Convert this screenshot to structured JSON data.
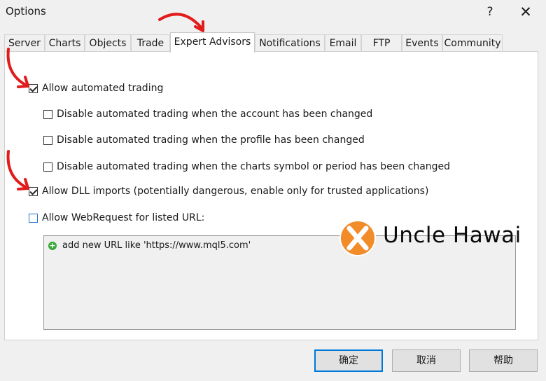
{
  "window": {
    "title": "Options",
    "help_glyph": "?",
    "close_glyph": "✕"
  },
  "tabs": [
    {
      "label": "Server",
      "active": false
    },
    {
      "label": "Charts",
      "active": false
    },
    {
      "label": "Objects",
      "active": false
    },
    {
      "label": "Trade",
      "active": false
    },
    {
      "label": "Expert Advisors",
      "active": true
    },
    {
      "label": "Notifications",
      "active": false
    },
    {
      "label": "Email",
      "active": false
    },
    {
      "label": "FTP",
      "active": false
    },
    {
      "label": "Events",
      "active": false
    },
    {
      "label": "Community",
      "active": false
    }
  ],
  "options": {
    "allow_automated": {
      "label": "Allow automated trading",
      "checked": true
    },
    "disable_account": {
      "label": "Disable automated trading when the account has been changed",
      "checked": false
    },
    "disable_profile": {
      "label": "Disable automated trading when the profile has been changed",
      "checked": false
    },
    "disable_symbol": {
      "label": "Disable automated trading when the charts symbol or period has been changed",
      "checked": false
    },
    "allow_dll": {
      "label": "Allow DLL imports (potentially dangerous, enable only for trusted applications)",
      "checked": true
    },
    "allow_webrequest": {
      "label": "Allow WebRequest for listed URL:",
      "checked": false
    }
  },
  "url_list": {
    "add_item": "add new URL like 'https://www.mql5.com'",
    "add_icon": "plus-circle-icon"
  },
  "watermark": {
    "brand": "Uncle Hawai",
    "logo_color": "#f28c28"
  },
  "buttons": {
    "ok": "确定",
    "cancel": "取消",
    "help": "帮助"
  },
  "colors": {
    "accent": "#0078d7",
    "arrow": "#e21b1b",
    "panel": "#ffffff",
    "background": "#f0f0f0"
  }
}
